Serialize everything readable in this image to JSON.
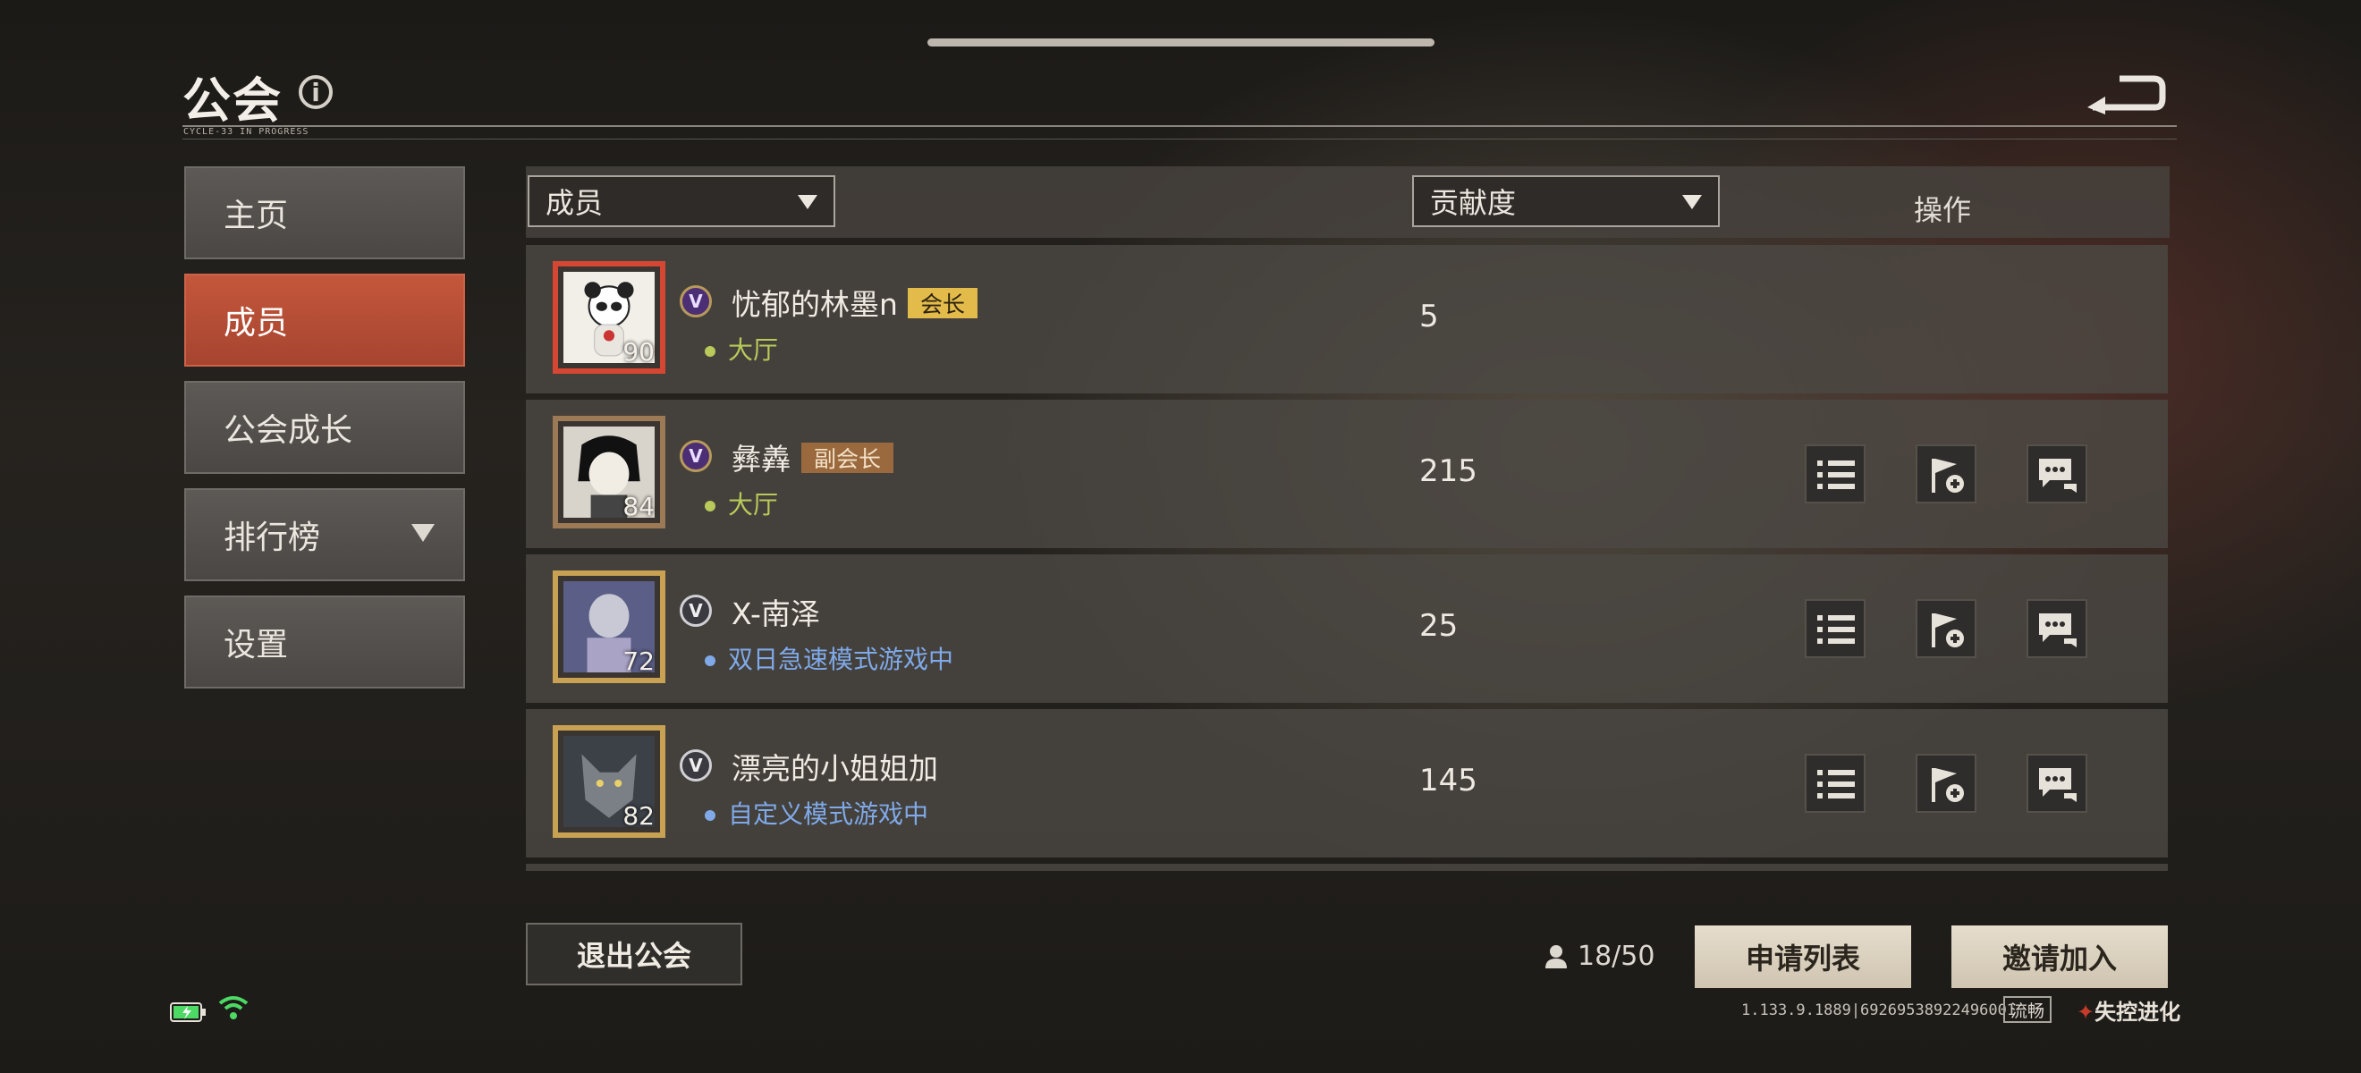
{
  "header": {
    "title": "公会",
    "subtitle": "CYCLE-33 IN PROGRESS"
  },
  "sidebar": {
    "items": [
      {
        "label": "主页",
        "active": false
      },
      {
        "label": "成员",
        "active": true
      },
      {
        "label": "公会成长",
        "active": false
      },
      {
        "label": "排行榜",
        "active": false,
        "has_dropdown": true
      },
      {
        "label": "设置",
        "active": false
      }
    ]
  },
  "table": {
    "member_filter": "成员",
    "sort_filter": "贡献度",
    "ops_header": "操作"
  },
  "members": [
    {
      "name": "忧郁的林墨n",
      "role": "会长",
      "status": "大厅",
      "level": "90",
      "contribution": "5",
      "status_type": "hall",
      "frame": "red",
      "show_ops": false
    },
    {
      "name": "彝羴",
      "role": "副会长",
      "status": "大厅",
      "level": "84",
      "contribution": "215",
      "status_type": "hall",
      "frame": "bronze",
      "show_ops": true
    },
    {
      "name": "X-南泽",
      "role": "",
      "status": "双日急速模式游戏中",
      "level": "72",
      "contribution": "25",
      "status_type": "game",
      "frame": "gold",
      "show_ops": true
    },
    {
      "name": "漂亮的小姐姐加",
      "role": "",
      "status": "自定义模式游戏中",
      "level": "82",
      "contribution": "145",
      "status_type": "game",
      "frame": "gold",
      "show_ops": true
    }
  ],
  "footer": {
    "leave_label": "退出公会",
    "member_count": "18/50",
    "apply_list_label": "申请列表",
    "invite_label": "邀请加入",
    "version": "1.133.9.1889|69269538922496001",
    "network": "流畅",
    "logo": "失控进化"
  },
  "colors": {
    "accent": "#c4573b",
    "leader_badge": "#e3bb4a",
    "vice_badge": "#9a6a3e",
    "hall_status": "#b9c95a",
    "game_status": "#7fa9e8"
  }
}
